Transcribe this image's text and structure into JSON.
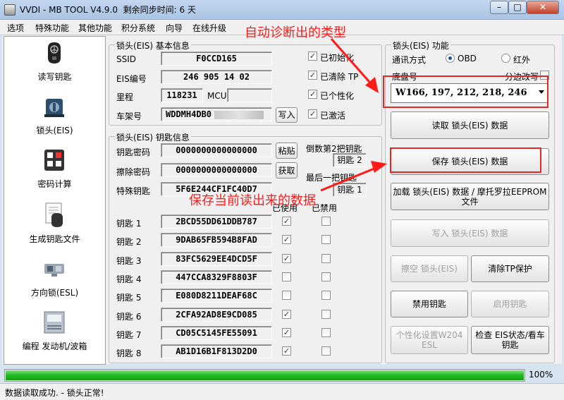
{
  "window": {
    "title": "VVDI - MB TOOL V4.9.0",
    "days_label": "剩余同步时间: 6 天",
    "min": "–",
    "max": "□",
    "close": "✕"
  },
  "menu": [
    "选项",
    "特殊功能",
    "其他功能",
    "积分系统",
    "向导",
    "在线升级"
  ],
  "nav": [
    {
      "label": "读写钥匙",
      "icon": "car-key-icon"
    },
    {
      "label": "锁头(EIS)",
      "icon": "eis-ignition-icon"
    },
    {
      "label": "密码计算",
      "icon": "password-calculator-icon"
    },
    {
      "label": "生成钥匙文件",
      "icon": "key-file-icon"
    },
    {
      "label": "方向锁(ESL)",
      "icon": "steering-lock-icon"
    },
    {
      "label": "编程 发动机/波箱",
      "icon": "ecu-module-icon"
    }
  ],
  "eis_info": {
    "title": "锁头(EIS) 基本信息",
    "ssid_label": "SSID",
    "ssid": "F0CCD165",
    "eis_no_label": "EIS编号",
    "eis_no": "246 905 14 02",
    "mileage_label": "里程",
    "mileage": "118231",
    "mcu_label": "MCU",
    "mcu": "",
    "vin_label": "车架号",
    "vin": "WDDMH4DB0",
    "write_btn": "写入",
    "checks": [
      {
        "label": "已初始化",
        "checked": true
      },
      {
        "label": "已清除 TP",
        "checked": true
      },
      {
        "label": "已个性化",
        "checked": true
      },
      {
        "label": "已激活",
        "checked": true
      }
    ]
  },
  "key_info": {
    "title": "锁头(EIS) 钥匙信息",
    "key_password_label": "钥匙密码",
    "key_password": "0000000000000000",
    "paste_btn": "粘贴",
    "erase_password_label": "擦除密码",
    "erase_password": "0000000000000000",
    "get_btn": "获取",
    "special_key_label": "特殊钥匙",
    "special_key": "5F6E244CF1FC40D7",
    "second_last_label": "倒数第2把钥匙",
    "second_last": "钥匙 2",
    "last_label": "最后一把钥匙",
    "last": "钥匙 1",
    "used_header": "已使用",
    "disabled_header": "已禁用",
    "keys": [
      {
        "label": "钥匙 1",
        "value": "2BCD55DD61DDB787",
        "used": true,
        "disabled": false
      },
      {
        "label": "钥匙 2",
        "value": "9DAB65FB594B8FAD",
        "used": true,
        "disabled": false
      },
      {
        "label": "钥匙 3",
        "value": "83FC5629EE4DCD5F",
        "used": true,
        "disabled": false
      },
      {
        "label": "钥匙 4",
        "value": "447CCA8329F8803F",
        "used": false,
        "disabled": false
      },
      {
        "label": "钥匙 5",
        "value": "E080D8211DEAF68C",
        "used": false,
        "disabled": false
      },
      {
        "label": "钥匙 6",
        "value": "2CFA92AD8E9CD085",
        "used": true,
        "disabled": false
      },
      {
        "label": "钥匙 7",
        "value": "CD05C5145FE55091",
        "used": true,
        "disabled": false
      },
      {
        "label": "钥匙 8",
        "value": "AB1D16B1F813D2D0",
        "used": true,
        "disabled": false
      }
    ]
  },
  "func": {
    "title": "锁头(EIS) 功能",
    "comm_label": "通讯方式",
    "obd": "OBD",
    "ir": "红外",
    "chassis_label": "底盘号",
    "split_label": "分边改写",
    "chassis_value": "W166, 197, 212, 218, 246",
    "buttons": {
      "read": "读取 锁头(EIS) 数据",
      "save": "保存 锁头(EIS) 数据",
      "load": "加载 锁头(EIS) 数据 / 摩托罗拉EEPROM文件",
      "write": "写入 锁头(EIS) 数据",
      "erase": "擦空 锁头(EIS)",
      "clear_tp": "清除TP保护",
      "disable_key": "禁用钥匙",
      "enable_key": "启用钥匙",
      "personalize": "个性化设置W204 ESL",
      "check": "检查 EIS状态/看车钥匙"
    }
  },
  "annotations": {
    "top": "自动诊断出的类型",
    "mid": "保存当前读出来的数据"
  },
  "progress": {
    "percent": 100,
    "text": "100%"
  },
  "status": "数据读取成功. - 锁头正常!"
}
